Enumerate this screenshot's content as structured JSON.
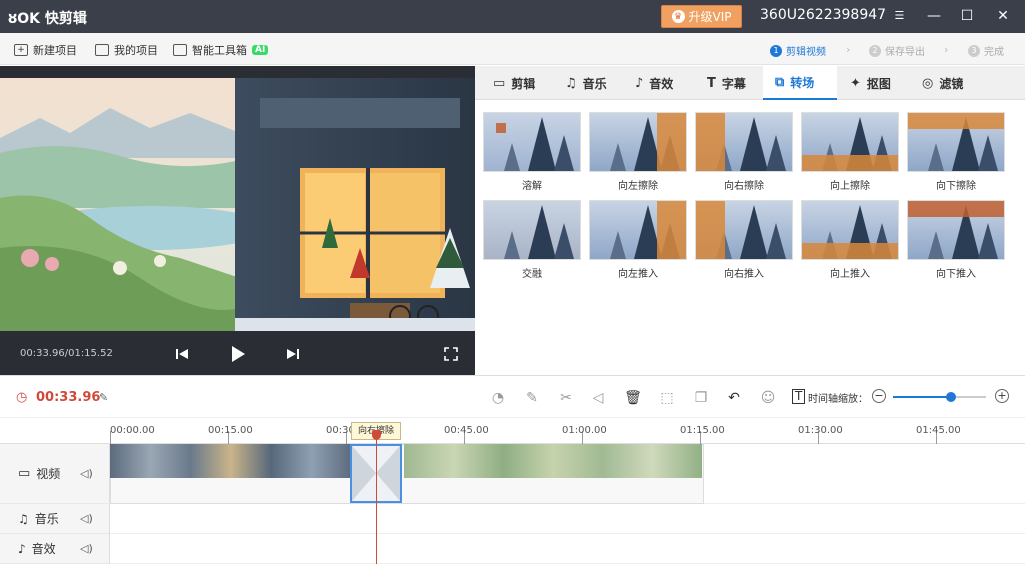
{
  "titlebar": {
    "logo": "ȣOK 快剪辑",
    "vip_label": "升级VIP",
    "user_id": "360U2622398947",
    "minimize": "—",
    "maximize": "☐",
    "close": "✕"
  },
  "menubar": {
    "items": [
      "新建项目",
      "我的项目",
      "智能工具箱"
    ],
    "ai_badge": "AI",
    "steps": [
      {
        "num": "1",
        "label": "剪辑视频"
      },
      {
        "num": "2",
        "label": "保存导出"
      },
      {
        "num": "3",
        "label": "完成"
      }
    ]
  },
  "preview": {
    "time": "00:33.96/01:15.52"
  },
  "tabs": [
    {
      "icon": "video-icon",
      "label": "剪辑"
    },
    {
      "icon": "music-icon",
      "label": "音乐"
    },
    {
      "icon": "sound-effect-icon",
      "label": "音效"
    },
    {
      "icon": "text-icon",
      "label": "字幕"
    },
    {
      "icon": "transition-icon",
      "label": "转场"
    },
    {
      "icon": "cutout-icon",
      "label": "抠图"
    },
    {
      "icon": "filter-icon",
      "label": "滤镜"
    }
  ],
  "transitions": [
    "溶解",
    "向左擦除",
    "向右擦除",
    "向上擦除",
    "向下擦除",
    "交融",
    "向左推入",
    "向右推入",
    "向上推入",
    "向下推入"
  ],
  "timeline": {
    "current_time": "00:33.96",
    "zoom_label": "时间轴缩放：",
    "zoom_level": 0.62,
    "ruler": [
      "00:00.00",
      "00:15.00",
      "00:30.00",
      "00:45.00",
      "01:00.00",
      "01:15.00",
      "01:30.00",
      "01:45.00"
    ],
    "transition_tooltip": "向右擦除",
    "tracks": [
      {
        "icon": "video-icon",
        "label": "视频"
      },
      {
        "icon": "music-icon",
        "label": "音乐"
      },
      {
        "icon": "sound-effect-icon",
        "label": "音效"
      }
    ]
  },
  "colors": {
    "accent": "#1e78d6",
    "titlebar": "#3a3f4a",
    "vip": "#f0a060",
    "time_red": "#d04a3a"
  }
}
